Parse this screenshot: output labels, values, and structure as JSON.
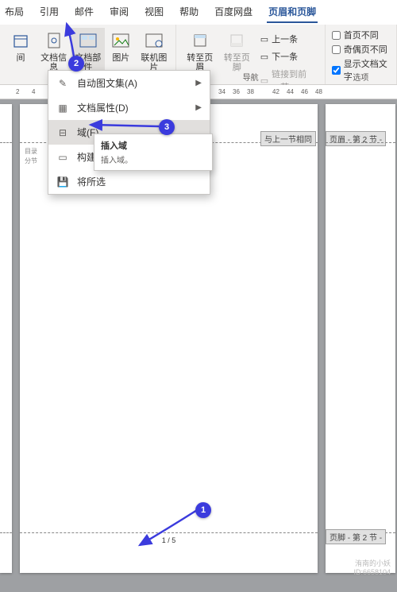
{
  "tabs": {
    "layout": "布局",
    "ref": "引用",
    "mail": "邮件",
    "review": "审阅",
    "view": "视图",
    "help": "帮助",
    "baidu": "百度网盘",
    "hf": "页眉和页脚"
  },
  "ribbon": {
    "span": "间",
    "docinfo": "文档信息",
    "parts": "文档部件",
    "pic": "图片",
    "online": "联机图片",
    "gohdr": "转至页眉",
    "goftr": "转至页脚",
    "prev": "上一条",
    "next": "下一条",
    "linkprev": "链接到前一节",
    "nav": "导航",
    "firstdiff": "首页不同",
    "odddiff": "奇偶页不同",
    "showtext": "显示文档文字",
    "optlabel": "选项"
  },
  "ruler": {
    "m2": "2",
    "m4": "4",
    "m34": "34",
    "m36": "36",
    "m38": "38",
    "m42": "42",
    "m44": "44",
    "m46": "46",
    "m48": "48"
  },
  "dropdown": {
    "autotext": "自动图文集(A)",
    "docprop": "文档属性(D)",
    "field": "域(F)...",
    "build": "构建基",
    "saveall": "将所选"
  },
  "tooltip": {
    "title": "插入域",
    "body": "插入域。"
  },
  "page": {
    "sameprev": "与上一节相同",
    "hdr2": "页眉 - 第 2 节 -",
    "ftr2": "页脚 - 第 2 节 -",
    "toc": "目录",
    "section": "分节",
    "footerpg": "1 / 5"
  },
  "badges": {
    "b1": "1",
    "b2": "2",
    "b3": "3"
  },
  "watermark": {
    "name": "洧南的小妖",
    "id": "ID:6658104"
  }
}
